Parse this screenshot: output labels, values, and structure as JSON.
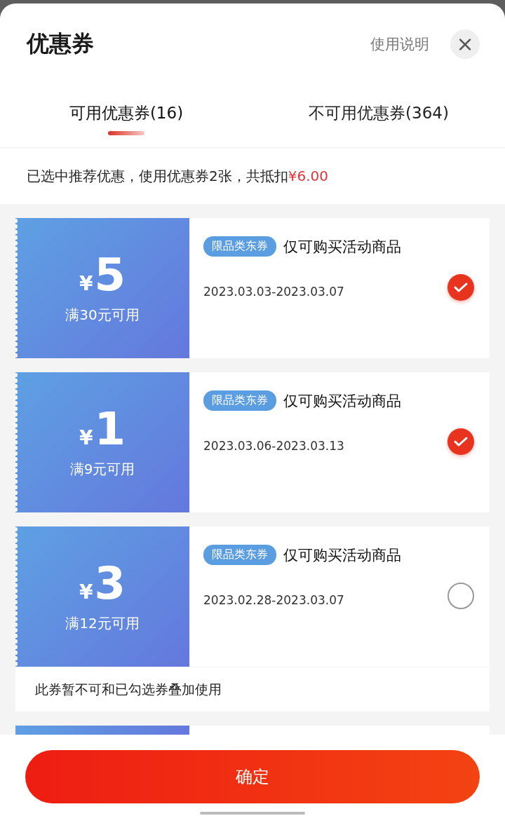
{
  "sheet": {
    "title": "优惠券",
    "help_link": "使用说明",
    "close_label": "×"
  },
  "tabs": [
    {
      "label": "可用优惠券(16)",
      "selected": true
    },
    {
      "label": "不可用优惠券(364)",
      "selected": false
    }
  ],
  "summary": {
    "text": "已选中推荐优惠，使用优惠券2张，共抵扣",
    "amount": "¥6.00"
  },
  "coupons": [
    {
      "currency": "¥",
      "amount": "5",
      "condition": "满30元可用",
      "tag": "限品类东券",
      "title": "仅可购买活动商品",
      "dates": "2023.03.03-2023.03.07",
      "selected": true
    },
    {
      "currency": "¥",
      "amount": "1",
      "condition": "满9元可用",
      "tag": "限品类东券",
      "title": "仅可购买活动商品",
      "dates": "2023.03.06-2023.03.13",
      "selected": true
    },
    {
      "currency": "¥",
      "amount": "3",
      "condition": "满12元可用",
      "tag": "限品类东券",
      "title": "仅可购买活动商品",
      "dates": "2023.02.28-2023.03.07",
      "selected": false,
      "note": "此券暂不可和已勾选券叠加使用"
    }
  ],
  "confirm_button": "确定"
}
